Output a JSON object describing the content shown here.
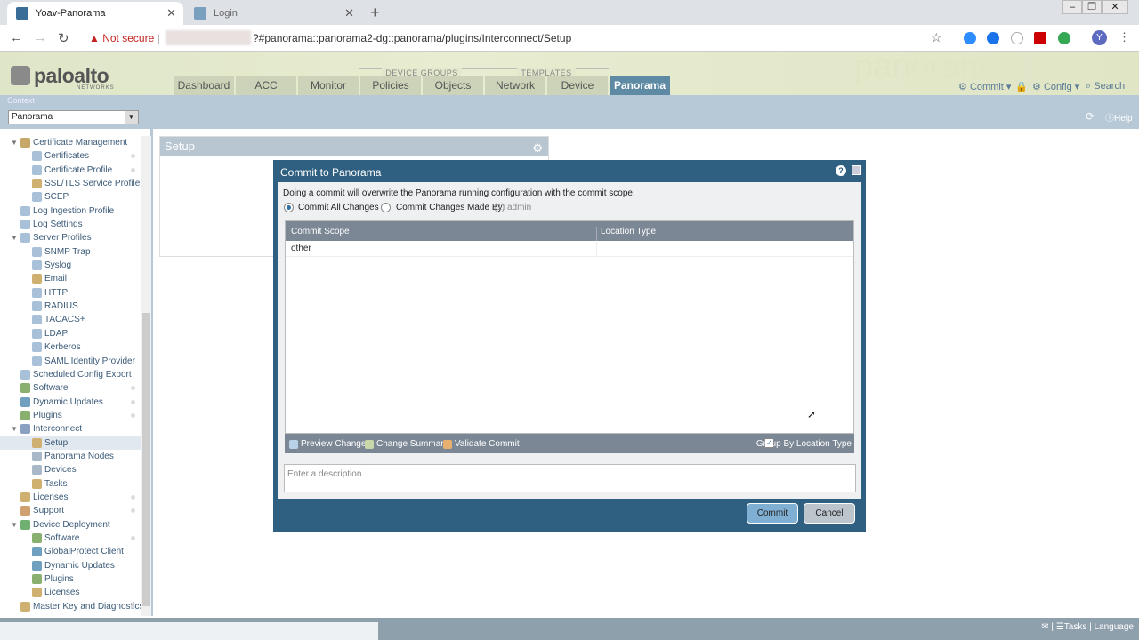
{
  "browser": {
    "tabs": [
      {
        "title": "Yoav-Panorama"
      },
      {
        "title": "Login"
      }
    ],
    "security_label": "Not secure",
    "url": "?#panorama::panorama2-dg::panorama/plugins/Interconnect/Setup",
    "profile_initial": "Y"
  },
  "header": {
    "logo": "paloalto",
    "logo_sub": "NETWORKS",
    "group_device_groups": "DEVICE GROUPS",
    "group_templates": "TEMPLATES",
    "tabs": [
      "Dashboard",
      "ACC",
      "Monitor",
      "Policies",
      "Objects",
      "Network",
      "Device",
      "Panorama"
    ],
    "commit": "Commit",
    "config": "Config",
    "search": "Search",
    "watermark": "panorama"
  },
  "context": {
    "label": "Context",
    "value": "Panorama",
    "refresh_label": "",
    "help": "Help"
  },
  "sidebar": {
    "items": [
      {
        "label": "Certificate Management"
      },
      {
        "label": "Certificates"
      },
      {
        "label": "Certificate Profile"
      },
      {
        "label": "SSL/TLS Service Profile"
      },
      {
        "label": "SCEP"
      },
      {
        "label": "Log Ingestion Profile"
      },
      {
        "label": "Log Settings"
      },
      {
        "label": "Server Profiles"
      },
      {
        "label": "SNMP Trap"
      },
      {
        "label": "Syslog"
      },
      {
        "label": "Email"
      },
      {
        "label": "HTTP"
      },
      {
        "label": "RADIUS"
      },
      {
        "label": "TACACS+"
      },
      {
        "label": "LDAP"
      },
      {
        "label": "Kerberos"
      },
      {
        "label": "SAML Identity Provider"
      },
      {
        "label": "Scheduled Config Export"
      },
      {
        "label": "Software"
      },
      {
        "label": "Dynamic Updates"
      },
      {
        "label": "Plugins"
      },
      {
        "label": "Interconnect"
      },
      {
        "label": "Setup"
      },
      {
        "label": "Panorama Nodes"
      },
      {
        "label": "Devices"
      },
      {
        "label": "Tasks"
      },
      {
        "label": "Licenses"
      },
      {
        "label": "Support"
      },
      {
        "label": "Device Deployment"
      },
      {
        "label": "Software"
      },
      {
        "label": "GlobalProtect Client"
      },
      {
        "label": "Dynamic Updates"
      },
      {
        "label": "Plugins"
      },
      {
        "label": "Licenses"
      },
      {
        "label": "Master Key and Diagnostics"
      }
    ]
  },
  "setup_panel": {
    "title": "Setup"
  },
  "dialog": {
    "title": "Commit to Panorama",
    "description": "Doing a commit will overwrite the Panorama running configuration with the commit scope.",
    "radio_all": "Commit All Changes",
    "radio_by": "Commit Changes Made By:",
    "radio_by_user": "(1) admin",
    "columns": [
      "Commit Scope",
      "Location Type"
    ],
    "rows": [
      {
        "scope": "other",
        "location_type": ""
      }
    ],
    "footer": {
      "preview": "Preview Changes",
      "summary": "Change Summary",
      "validate": "Validate Commit",
      "group_by": "Group By Location Type"
    },
    "description_placeholder": "Enter a description",
    "commit_button": "Commit",
    "cancel_button": "Cancel"
  },
  "statusbar": {
    "tasks": "Tasks",
    "language": "Language"
  }
}
